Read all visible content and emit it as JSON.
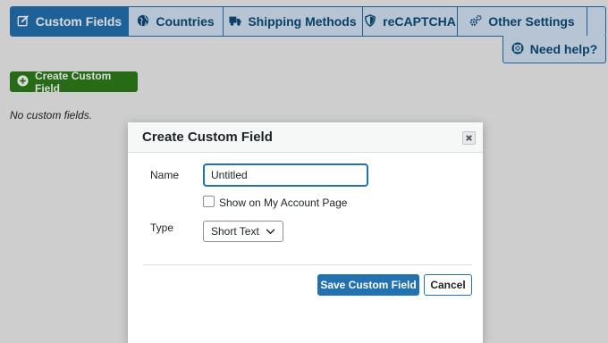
{
  "tabs": [
    {
      "label": "Custom Fields",
      "icon": "edit-icon",
      "active": true
    },
    {
      "label": "Countries",
      "icon": "globe-icon",
      "active": false
    },
    {
      "label": "Shipping Methods",
      "icon": "truck-icon",
      "active": false
    },
    {
      "label": "reCAPTCHA",
      "icon": "shield-icon",
      "active": false
    },
    {
      "label": "Other Settings",
      "icon": "gears-icon",
      "active": false
    }
  ],
  "help": {
    "label": "Need help?",
    "icon": "lifebuoy-icon"
  },
  "main": {
    "create_label": "Create Custom Field",
    "create_icon": "plus-circle-icon",
    "empty_text": "No custom fields."
  },
  "modal": {
    "title": "Create Custom Field",
    "name_label": "Name",
    "name_value": "Untitled",
    "checkbox_label": "Show on My Account Page",
    "checkbox_checked": false,
    "type_label": "Type",
    "type_value": "Short Text",
    "save_label": "Save Custom Field",
    "cancel_label": "Cancel"
  },
  "colors": {
    "accent": "#2271b1",
    "tab_bg": "#d4e5f6",
    "create_button": "#2e7d1a"
  }
}
